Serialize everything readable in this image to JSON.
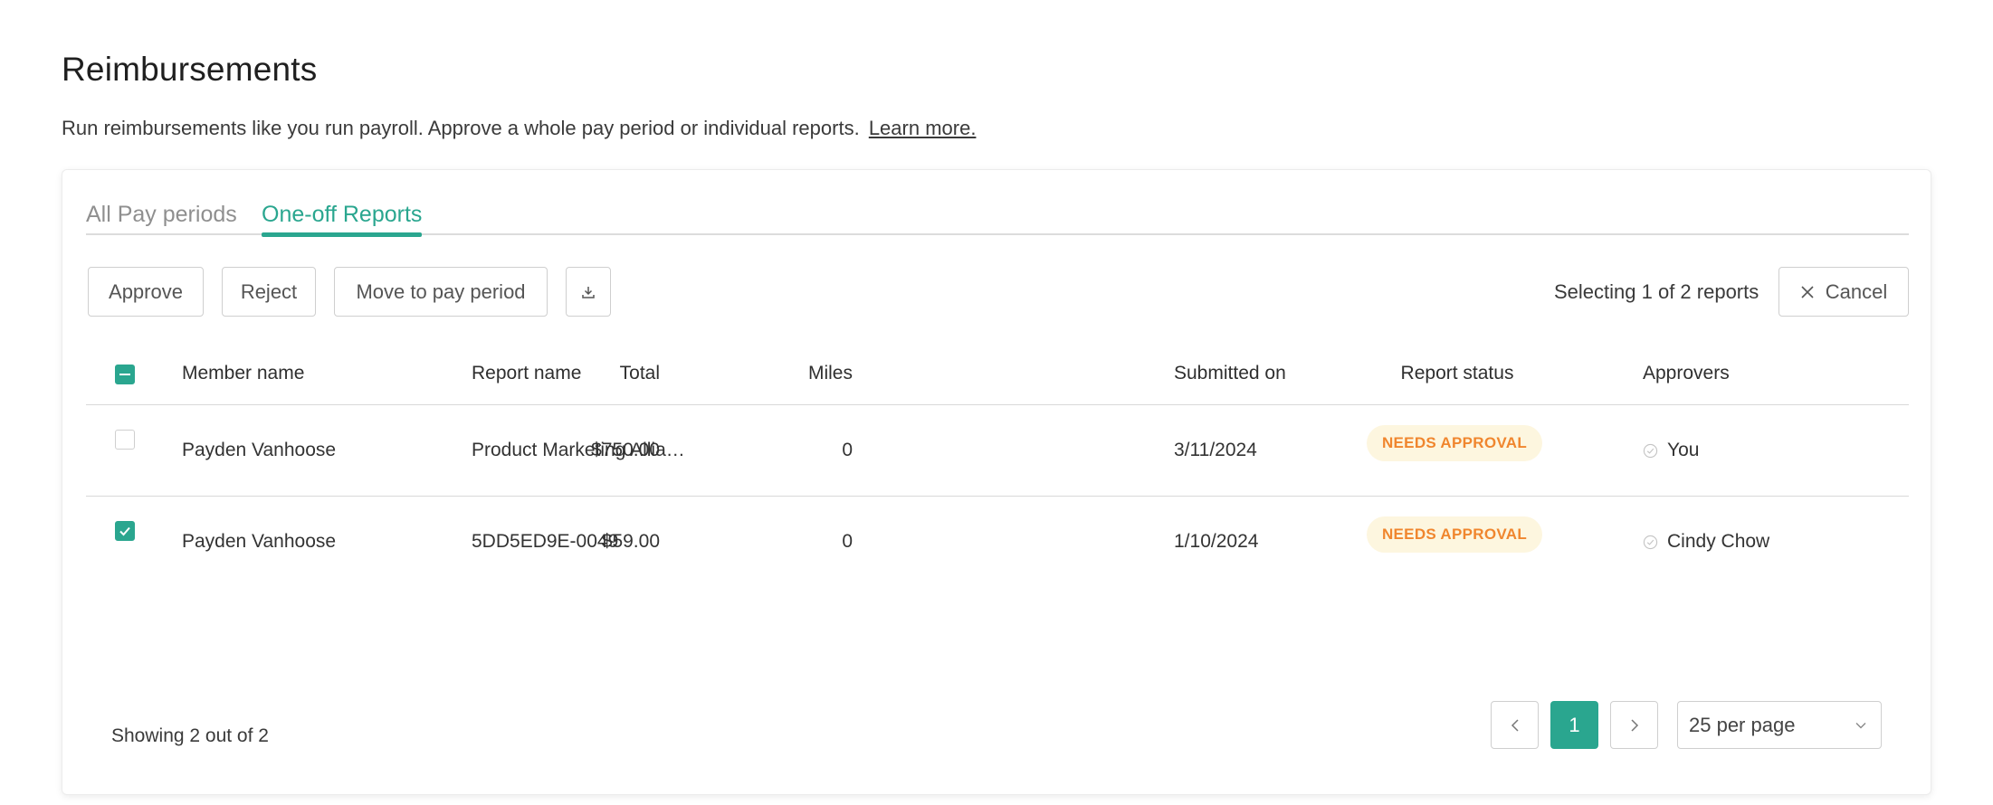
{
  "header": {
    "title": "Reimbursements",
    "description": "Run reimbursements like you run payroll. Approve a whole pay period or individual reports.",
    "learn_more": "Learn more."
  },
  "tabs": [
    {
      "label": "All Pay periods",
      "active": false
    },
    {
      "label": "One-off Reports",
      "active": true
    }
  ],
  "toolbar": {
    "approve": "Approve",
    "reject": "Reject",
    "move": "Move to pay period",
    "download_icon": "download-icon",
    "selection": "Selecting 1 of 2 reports",
    "cancel": "Cancel"
  },
  "table": {
    "columns": {
      "member": "Member name",
      "report": "Report name",
      "total": "Total",
      "miles": "Miles",
      "submitted": "Submitted on",
      "status": "Report status",
      "approvers": "Approvers"
    },
    "rows": [
      {
        "checked": false,
        "member": "Payden Vanhoose",
        "report": "Product Marketing Allia…",
        "total": "$750.00",
        "miles": "0",
        "submitted": "3/11/2024",
        "status": "NEEDS APPROVAL",
        "approver": "You"
      },
      {
        "checked": true,
        "member": "Payden Vanhoose",
        "report": "5DD5ED9E-0049",
        "total": "$59.00",
        "miles": "0",
        "submitted": "1/10/2024",
        "status": "NEEDS APPROVAL",
        "approver": "Cindy Chow"
      }
    ]
  },
  "footer": {
    "showing": "Showing 2 out of 2",
    "current_page": "1",
    "per_page": "25 per page"
  },
  "colors": {
    "accent": "#2aa68f",
    "badge_bg": "#fdf6df",
    "badge_text": "#f0862e"
  }
}
